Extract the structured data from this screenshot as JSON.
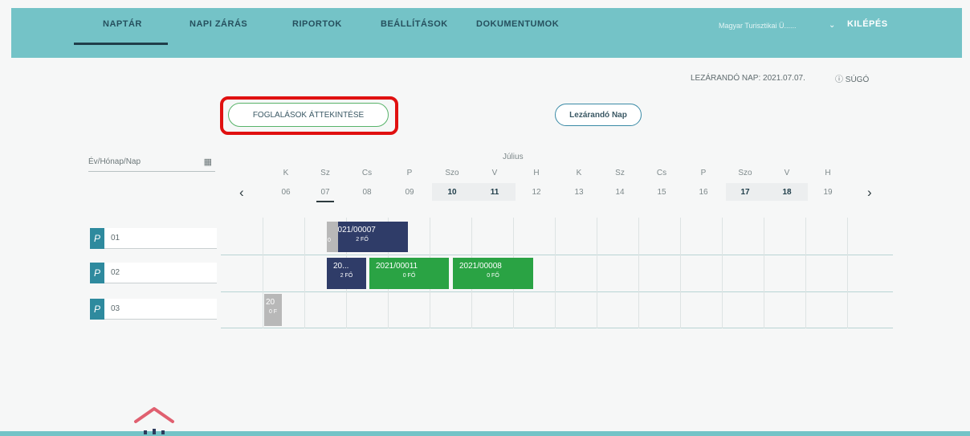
{
  "nav": {
    "items": [
      "NAPTÁR",
      "NAPI ZÁRÁS",
      "RIPORTOK",
      "BEÁLLÍTÁSOK",
      "DOKUMENTUMOK"
    ],
    "active": "NAPTÁR",
    "organization": "Magyar Turisztikai Ü......",
    "logout": "KILÉPÉS"
  },
  "header": {
    "closing_day": "LEZÁRANDÓ NAP: 2021.07.07.",
    "help": "ⓘ SÚGÓ"
  },
  "buttons": {
    "overview": "FOGLALÁSOK ÁTTEKINTÉSE",
    "closing_day": "Lezárandó Nap"
  },
  "date_picker": {
    "placeholder": "Év/Hónap/Nap"
  },
  "calendar": {
    "month": "Július",
    "days": [
      {
        "name": "K",
        "date": "06"
      },
      {
        "name": "Sz",
        "date": "07"
      },
      {
        "name": "Cs",
        "date": "08"
      },
      {
        "name": "P",
        "date": "09"
      },
      {
        "name": "Szo",
        "date": "10"
      },
      {
        "name": "V",
        "date": "11"
      },
      {
        "name": "H",
        "date": "12"
      },
      {
        "name": "K",
        "date": "13"
      },
      {
        "name": "Sz",
        "date": "14"
      },
      {
        "name": "Cs",
        "date": "15"
      },
      {
        "name": "P",
        "date": "16"
      },
      {
        "name": "Szo",
        "date": "17"
      },
      {
        "name": "V",
        "date": "18"
      },
      {
        "name": "H",
        "date": "19"
      }
    ]
  },
  "rooms": [
    {
      "icon": "P",
      "name": "01"
    },
    {
      "icon": "P",
      "name": "02"
    },
    {
      "icon": "P",
      "name": "03"
    }
  ],
  "bookings": {
    "b1": {
      "id": "2021/00007",
      "guests": "2 FŐ",
      "prefix": "0"
    },
    "b2": {
      "id": "20...",
      "guests": "2 FŐ"
    },
    "b3": {
      "id": "2021/00011",
      "guests": "0 FŐ"
    },
    "b4": {
      "id": "2021/00008",
      "guests": "0 FŐ"
    },
    "b5": {
      "id": "20",
      "guests": "0 F"
    }
  },
  "colors": {
    "topbar": "#74c3c7",
    "booking_navy": "#2f3c68",
    "booking_green": "#2aa344",
    "booking_grey": "#b8b8b8",
    "highlight": "#e01010"
  }
}
